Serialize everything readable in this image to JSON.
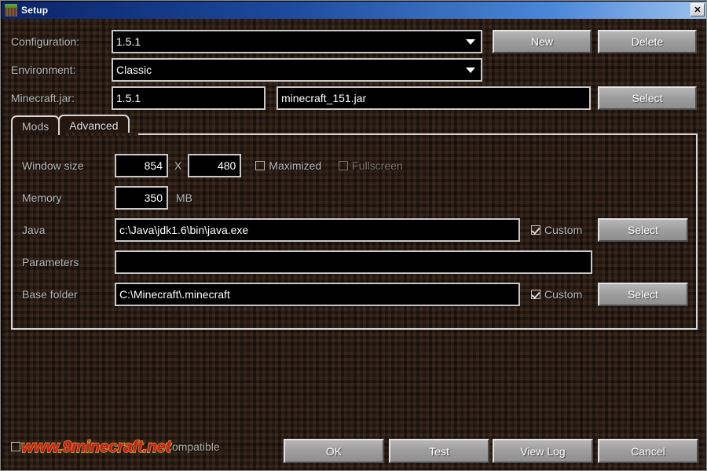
{
  "window": {
    "title": "Setup",
    "icon": "grass-block-icon",
    "close_label": "✕"
  },
  "form": {
    "configuration": {
      "label": "Configuration:",
      "value": "1.5.1",
      "new_button": "New",
      "delete_button": "Delete"
    },
    "environment": {
      "label": "Environment:",
      "value": "Classic"
    },
    "minecraft_jar": {
      "label": "Minecraft.jar:",
      "version_value": "1.5.1",
      "file_value": "minecraft_151.jar",
      "select_button": "Select"
    }
  },
  "tabs": [
    {
      "label": "Mods",
      "active": false
    },
    {
      "label": "Advanced",
      "active": true
    }
  ],
  "advanced": {
    "window_size": {
      "label": "Window size",
      "width_value": "854",
      "separator": "X",
      "height_value": "480",
      "maximized_label": "Maximized",
      "maximized_checked": false,
      "fullscreen_label": "Fullscreen",
      "fullscreen_checked": false,
      "fullscreen_disabled": true
    },
    "memory": {
      "label": "Memory",
      "value": "350",
      "unit": "MB"
    },
    "java": {
      "label": "Java",
      "value": "c:\\Java\\jdk1.6\\bin\\java.exe",
      "custom_label": "Custom",
      "custom_checked": true,
      "select_button": "Select"
    },
    "parameters": {
      "label": "Parameters",
      "value": "",
      "placeholder": ""
    },
    "base_folder": {
      "label": "Base folder",
      "value": "C:\\Minecraft\\.minecraft",
      "custom_label": "Custom",
      "custom_checked": true,
      "select_button": "Select"
    }
  },
  "footer": {
    "watermark_text": "www.9minecraft.net",
    "compatible_label": "compatible",
    "buttons": {
      "ok": "OK",
      "test": "Test",
      "view_log": "View Log",
      "cancel": "Cancel"
    }
  },
  "colors": {
    "title_bar_start": "#0a246a",
    "title_bar_end": "#9cc2ef",
    "background": "#2b1d15",
    "input_bg": "#000000",
    "input_border": "#c9c9c9",
    "label_text": "#b9b9b9",
    "button_face": "#9d9d9d",
    "watermark_red": "#d81616",
    "watermark_yellow": "#f4e04a"
  }
}
